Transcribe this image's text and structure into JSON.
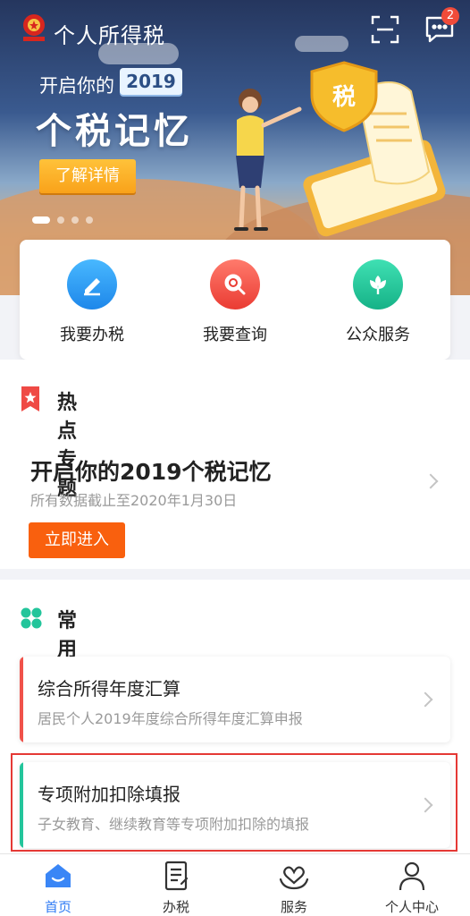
{
  "header": {
    "app_title": "个人所得税",
    "message_count": "2"
  },
  "banner": {
    "line1": "开启你的",
    "year": "2019",
    "headline": "个税记忆",
    "cta": "了解详情",
    "illustration_badge": "税",
    "slide_count": 4,
    "active_slide": 0
  },
  "quick_actions": [
    {
      "label": "我要办税",
      "icon": "pencil-icon",
      "color": "#2e9cf5"
    },
    {
      "label": "我要查询",
      "icon": "search-icon",
      "color": "#f0524a"
    },
    {
      "label": "公众服务",
      "icon": "flower-icon",
      "color": "#23c59b"
    }
  ],
  "hot_topics": {
    "section_title": "热点专题",
    "item_title": "开启你的2019个税记忆",
    "item_subtitle": "所有数据截止至2020年1月30日",
    "button": "立即进入"
  },
  "common_business": {
    "section_title": "常用业务",
    "items": [
      {
        "title": "综合所得年度汇算",
        "subtitle": "居民个人2019年度综合所得年度汇算申报",
        "accent": "#f0524a"
      },
      {
        "title": "专项附加扣除填报",
        "subtitle": "子女教育、继续教育等专项附加扣除的填报",
        "accent": "#23c59b"
      }
    ]
  },
  "tabbar": {
    "items": [
      {
        "label": "首页",
        "icon": "home-icon",
        "active": true
      },
      {
        "label": "办税",
        "icon": "document-icon",
        "active": false
      },
      {
        "label": "服务",
        "icon": "heart-hand-icon",
        "active": false
      },
      {
        "label": "个人中心",
        "icon": "user-icon",
        "active": false
      }
    ]
  },
  "colors": {
    "primary": "#2f7bf4",
    "orange_button": "#f9600e",
    "banner_button": "#f9a21a",
    "badge": "#f04b3a"
  }
}
